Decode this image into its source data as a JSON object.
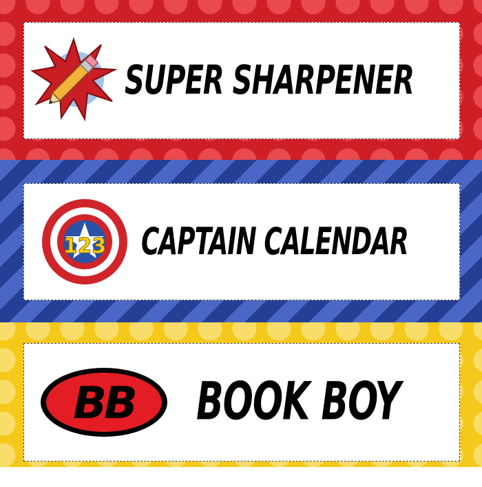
{
  "cards": [
    {
      "label": "Super Sharpener",
      "icon": "pencil-burst-icon"
    },
    {
      "label": "Captain Calendar",
      "icon": "shield-123-icon",
      "icon_text": "123"
    },
    {
      "label": "Book Boy",
      "icon": "bb-emblem-icon",
      "icon_text": "BB"
    }
  ],
  "colors": {
    "red_band": "#cf1f26",
    "blue_band": "#2b4aa6",
    "yellow_band": "#f5c81c",
    "card": "#ffffff",
    "text": "#000000"
  }
}
